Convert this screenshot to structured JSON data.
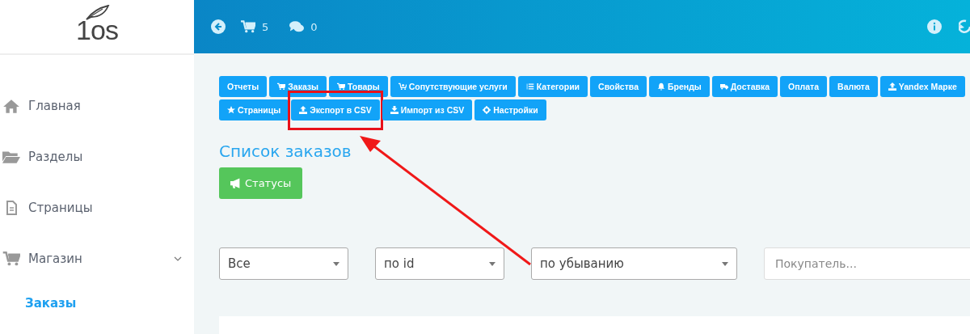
{
  "logo": {
    "text": "1os"
  },
  "topbar": {
    "cart_count": "5",
    "comments_count": "0"
  },
  "sidebar": {
    "items": [
      {
        "label": "Главная",
        "expandable": false,
        "selected": false
      },
      {
        "label": "Разделы",
        "expandable": false,
        "selected": false
      },
      {
        "label": "Страницы",
        "expandable": false,
        "selected": false
      },
      {
        "label": "Магазин",
        "expandable": true,
        "selected": false
      },
      {
        "label": "Заказы",
        "expandable": false,
        "selected": true
      }
    ]
  },
  "toolbar_top": [
    {
      "label": "Отчеты",
      "highlighted": false
    },
    {
      "label": "Заказы",
      "highlighted": false
    },
    {
      "label": "Товары",
      "highlighted": false
    },
    {
      "label": "Сопутствующие услуги",
      "highlighted": false
    },
    {
      "label": "Категории",
      "highlighted": false
    },
    {
      "label": "Свойства",
      "highlighted": false
    },
    {
      "label": "Бренды",
      "highlighted": false
    },
    {
      "label": "Доставка",
      "highlighted": false
    },
    {
      "label": "Оплата",
      "highlighted": false
    },
    {
      "label": "Валюта",
      "highlighted": false
    },
    {
      "label": "Yandex Марке",
      "highlighted": false
    }
  ],
  "toolbar_bottom": [
    {
      "label": "Страницы",
      "highlighted": false
    },
    {
      "label": "Экспорт в CSV",
      "highlighted": true
    },
    {
      "label": "Импорт из CSV",
      "highlighted": false
    },
    {
      "label": "Настройки",
      "highlighted": false
    }
  ],
  "heading": "Список заказов",
  "statuses_button": "Статусы",
  "filters": [
    {
      "kind": "select",
      "value": "Все"
    },
    {
      "kind": "select",
      "value": "по id"
    },
    {
      "kind": "select",
      "value": "по убыванию"
    },
    {
      "kind": "input",
      "placeholder": "Покупатель..."
    }
  ]
}
